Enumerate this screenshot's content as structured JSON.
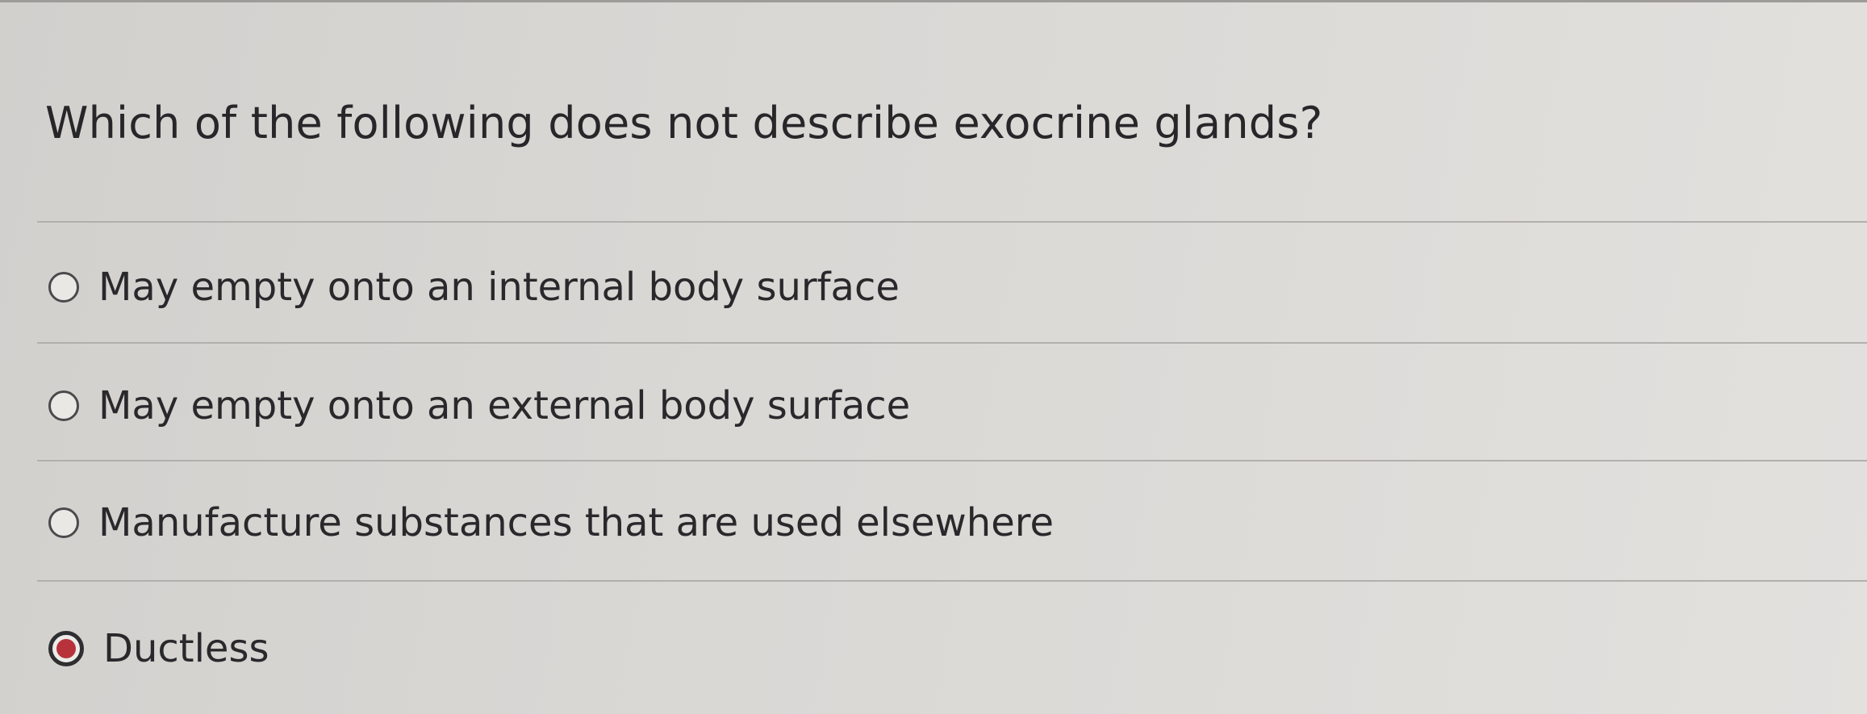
{
  "question": {
    "text": "Which of the following does not describe exocrine glands?"
  },
  "options": [
    {
      "label": "May empty onto an internal body surface",
      "selected": false
    },
    {
      "label": "May empty onto an external body surface",
      "selected": false
    },
    {
      "label": "Manufacture substances that are used elsewhere",
      "selected": false
    },
    {
      "label": "Ductless",
      "selected": true
    }
  ],
  "colors": {
    "selected_accent": "#b8323c",
    "text": "#2b2b2e"
  }
}
